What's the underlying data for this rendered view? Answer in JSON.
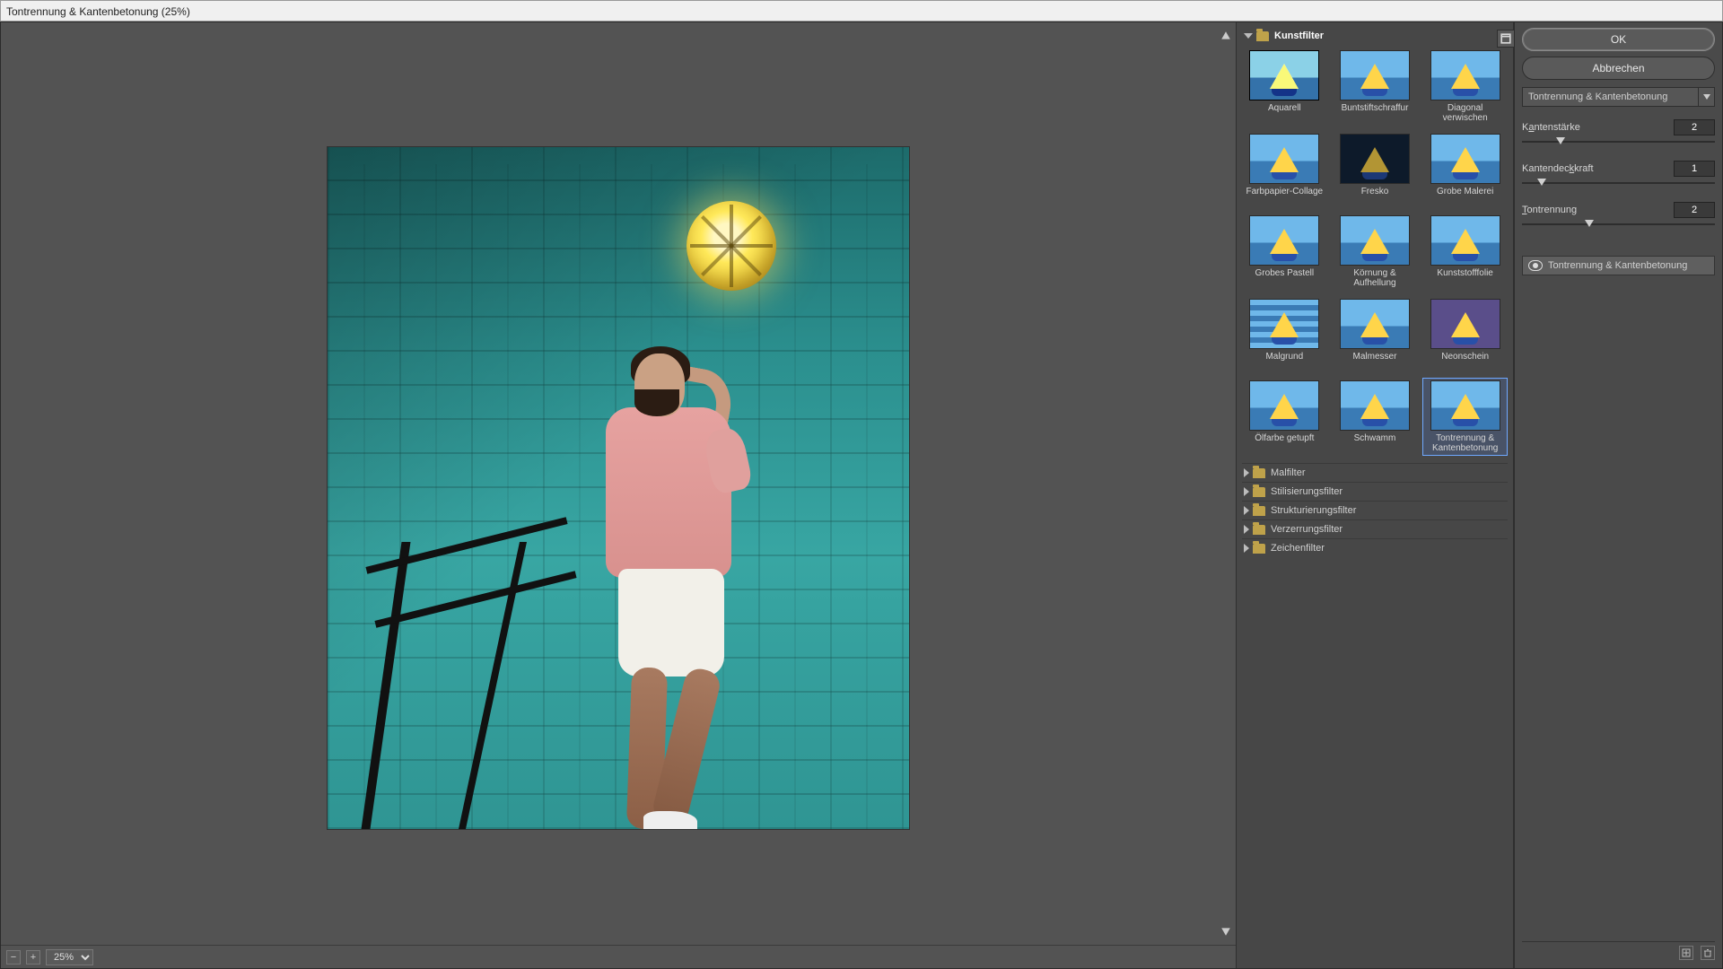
{
  "window": {
    "title": "Tontrennung & Kantenbetonung (25%)"
  },
  "preview": {
    "zoom": "25%"
  },
  "filter_tree": {
    "open_category": "Kunstfilter",
    "selected_thumb": "Tontrennung & Kantenbetonung",
    "thumbs": [
      {
        "label": "Aquarell"
      },
      {
        "label": "Buntstiftschraffur"
      },
      {
        "label": "Diagonal verwischen"
      },
      {
        "label": "Farbpapier-Collage"
      },
      {
        "label": "Fresko"
      },
      {
        "label": "Grobe Malerei"
      },
      {
        "label": "Grobes Pastell"
      },
      {
        "label": "Körnung & Aufhellung"
      },
      {
        "label": "Kunststofffolie"
      },
      {
        "label": "Malgrund"
      },
      {
        "label": "Malmesser"
      },
      {
        "label": "Neonschein"
      },
      {
        "label": "Ölfarbe getupft"
      },
      {
        "label": "Schwamm"
      },
      {
        "label": "Tontrennung & Kantenbetonung"
      }
    ],
    "collapsed_categories": [
      "Malfilter",
      "Stilisierungsfilter",
      "Strukturierungsfilter",
      "Verzerrungsfilter",
      "Zeichenfilter"
    ]
  },
  "controls": {
    "ok": "OK",
    "cancel": "Abbrechen",
    "filter_select": "Tontrennung & Kantenbetonung",
    "params": {
      "kantenstaerke": {
        "label": "Kantenstärke",
        "value": "2",
        "pos": 20
      },
      "kantendeckkraft": {
        "label": "Kantendeckkraft",
        "value": "1",
        "pos": 10
      },
      "tontrennung": {
        "label": "Tontrennung",
        "value": "2",
        "pos": 35
      }
    }
  },
  "layers": {
    "active": "Tontrennung & Kantenbetonung"
  }
}
